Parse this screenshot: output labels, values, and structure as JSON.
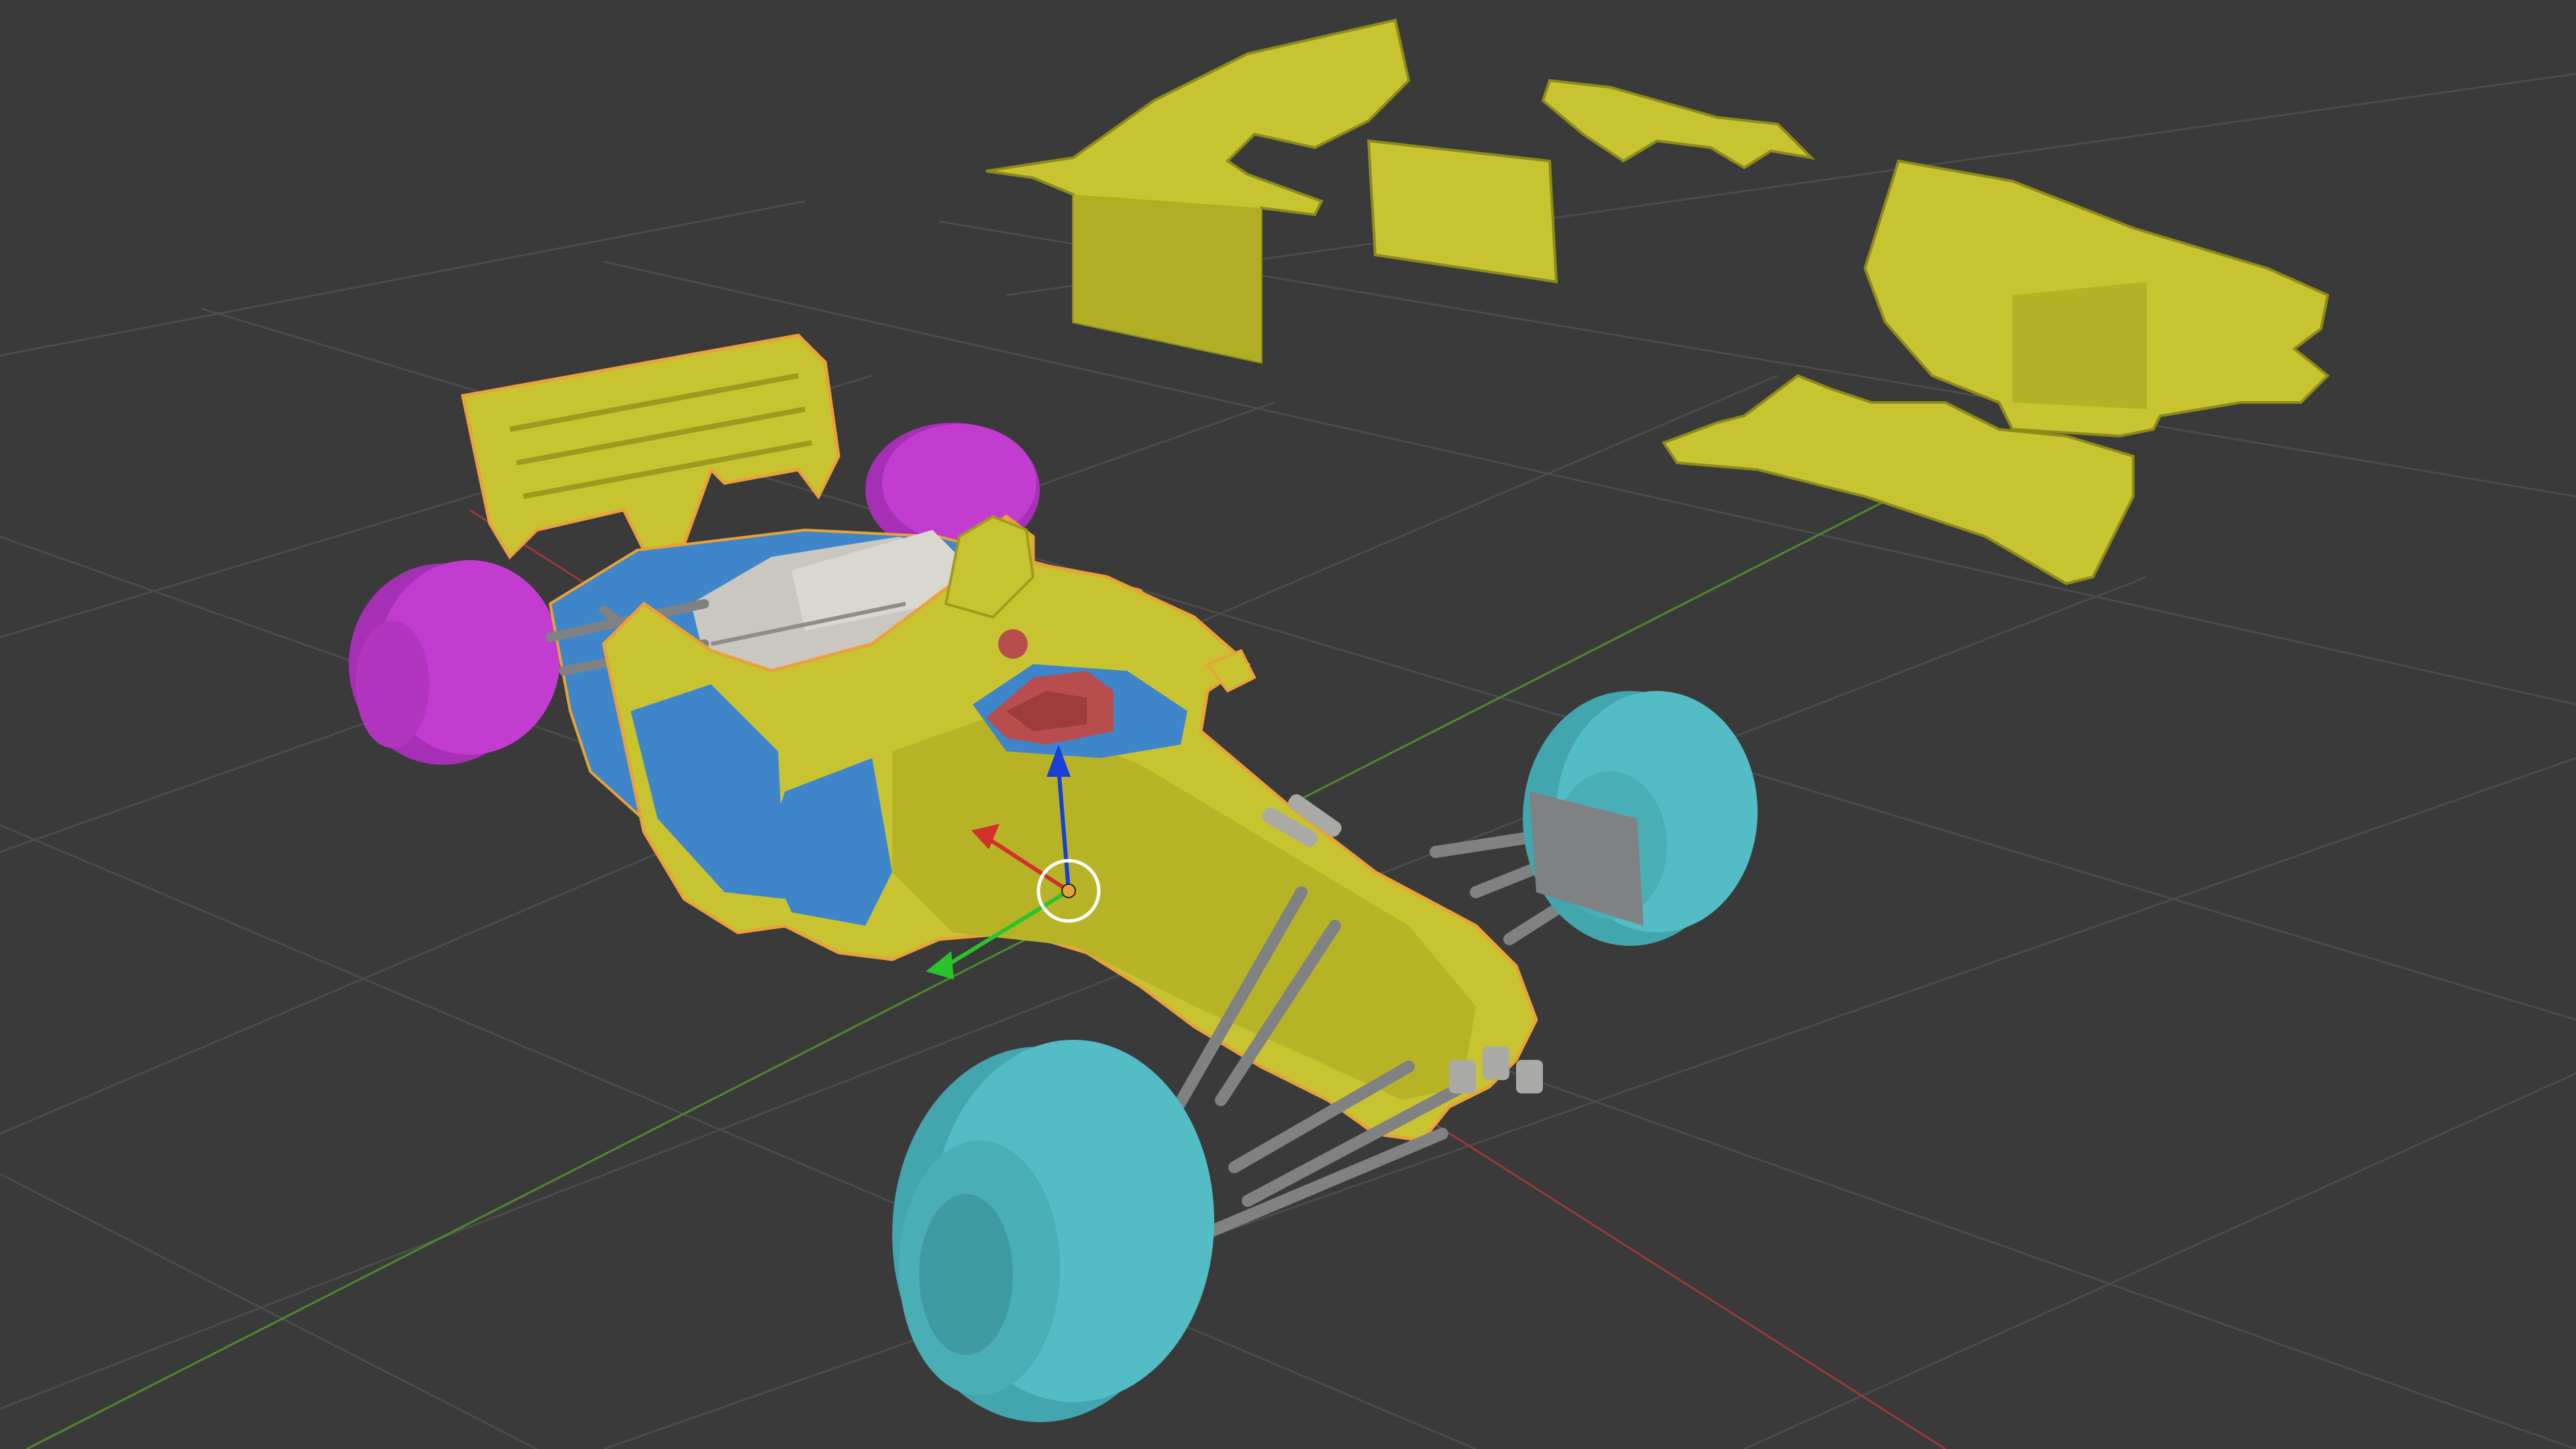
{
  "viewport": {
    "mode": "3d-viewport",
    "shading": "solid",
    "background_color": "#3a3a3a",
    "grid_color": "#4c4c4c",
    "axis_x_color": "#9b3b3b",
    "axis_y_color": "#4e8a2e"
  },
  "scene": {
    "object": "formula-one-car",
    "state": "bodywork-exploded",
    "colors": {
      "bodywork": "#c8c431",
      "bodywork_shade": "#9d9a1f",
      "sidepod_inner": "#3e86c9",
      "rear_tire": "#c33cd0",
      "front_tire": "#54bcc4",
      "suspension": "#7f8183",
      "seat": "#b84d4d",
      "engine": "#c9c7c0",
      "selection_outline": "#e8a23a"
    }
  },
  "gizmo": {
    "type": "transform-manipulator",
    "axes": [
      {
        "name": "z",
        "color": "#1a3fd6"
      },
      {
        "name": "x",
        "color": "#d2302c"
      },
      {
        "name": "y",
        "color": "#29c42d"
      }
    ],
    "pivot_color": "#e6a23a"
  }
}
